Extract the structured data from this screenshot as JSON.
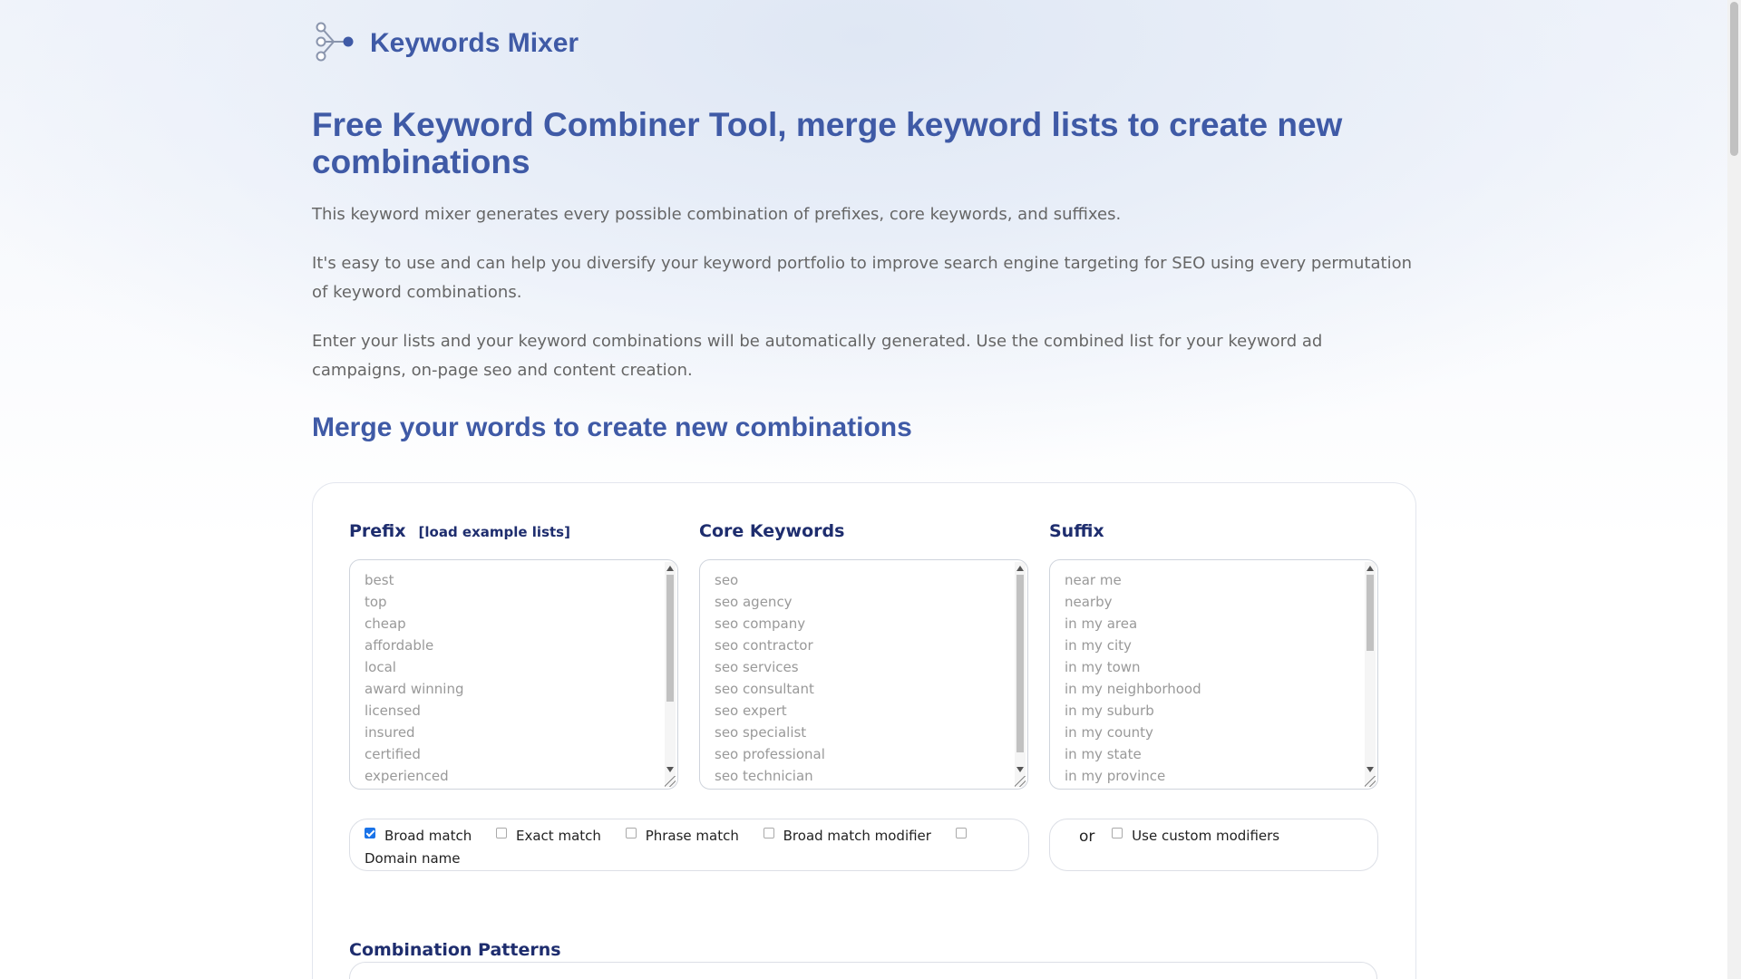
{
  "brand": {
    "name": "Keywords Mixer",
    "logo_icon": "network-nodes-icon"
  },
  "page": {
    "title": "Free Keyword Combiner Tool, merge keyword lists to create new combinations",
    "intro": [
      "This keyword mixer generates every possible combination of prefixes, core keywords, and suffixes.",
      "It's easy to use and can help you diversify your keyword portfolio to improve search engine targeting for SEO using every permutation of keyword combinations.",
      "Enter your lists and your keyword combinations will be automatically generated. Use the combined list for your keyword ad campaigns, on-page seo and content creation."
    ],
    "section_title": "Merge your words to create new combinations"
  },
  "tool": {
    "prefix": {
      "label": "Prefix",
      "load_link": "[load example lists]",
      "items": [
        "best",
        "top",
        "cheap",
        "affordable",
        "local",
        "award winning",
        "licensed",
        "insured",
        "certified",
        "experienced"
      ]
    },
    "core": {
      "label": "Core Keywords",
      "items": [
        "seo",
        "seo agency",
        "seo company",
        "seo contractor",
        "seo services",
        "seo consultant",
        "seo expert",
        "seo specialist",
        "seo professional",
        "seo technician"
      ]
    },
    "suffix": {
      "label": "Suffix",
      "items": [
        "near me",
        "nearby",
        "in my area",
        "in my city",
        "in my town",
        "in my neighborhood",
        "in my suburb",
        "in my county",
        "in my state",
        "in my province"
      ]
    },
    "match_options": [
      {
        "label": "Broad match",
        "checked": true
      },
      {
        "label": "Exact match",
        "checked": false
      },
      {
        "label": "Phrase match",
        "checked": false
      },
      {
        "label": "Broad match modifier",
        "checked": false
      },
      {
        "label": "Domain name",
        "checked": false
      }
    ],
    "or_label": "or",
    "custom_modifiers_label": "Use custom modifiers",
    "patterns_label": "Combination Patterns"
  },
  "colors": {
    "heading": "#3f5aa6",
    "label": "#1e2d6e",
    "checkbox": "#1a73e8"
  }
}
